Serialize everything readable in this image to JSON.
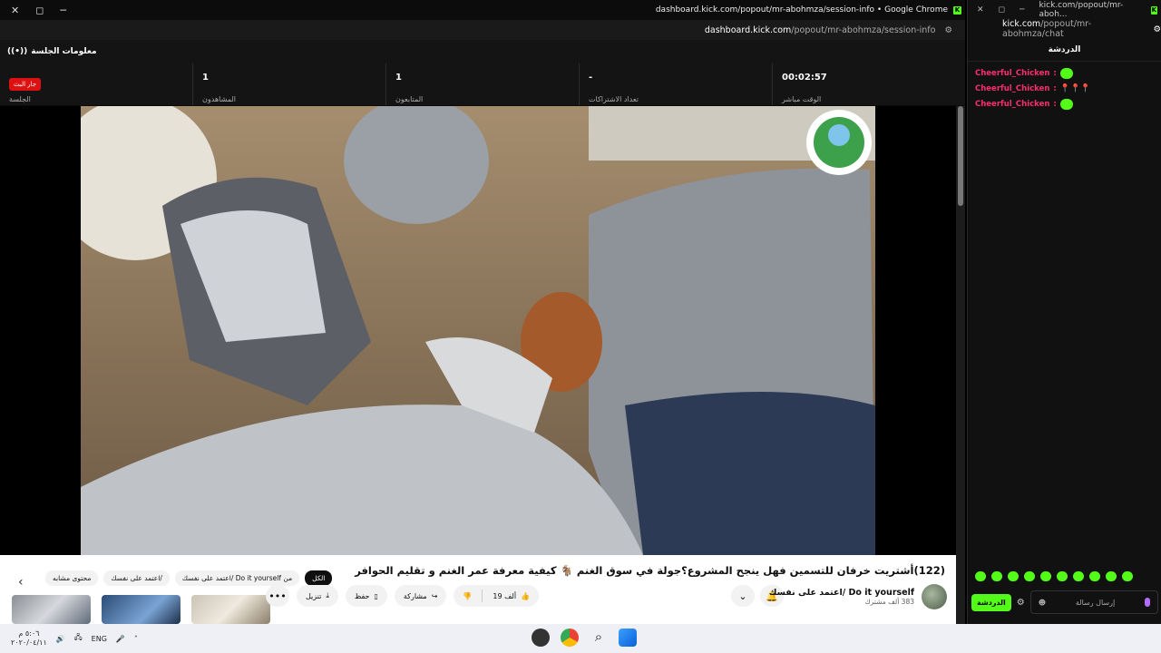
{
  "main_window": {
    "title": "dashboard.kick.com/popout/mr-abohmza/session-info • Google Chrome",
    "url_domain": "dashboard.kick.com",
    "url_path": "/popout/mr-abohmza/session-info",
    "controls": {
      "close": "✕",
      "restore": "◻",
      "minimize": "─"
    }
  },
  "session": {
    "heading": "معلومات الجلسة",
    "live_label": "جار البث",
    "session_label": "الجلسة",
    "stats": [
      {
        "value": "1",
        "label": "المشاهدون"
      },
      {
        "value": "1",
        "label": "المتابعون"
      },
      {
        "value": "-",
        "label": "تعداد الاشتراكات"
      },
      {
        "value": "00:02:57",
        "label": "الوقت مباشر"
      }
    ]
  },
  "youtube": {
    "video_title": "(122)أشتريت خرفان للتسمين فهل ينجح المشروع؟جولة في سوق الغنم 🐐 كيفية معرفة عمر الغنم و تقليم الحوافر",
    "channel_name": "Do it yourself /اعتمد على نفسك",
    "channel_subs": "383 ألف مشترك",
    "like_count": "19 ألف",
    "actions": {
      "share": "مشاركة",
      "save": "حفظ",
      "download": "تنزيل",
      "more": "•••"
    },
    "chips": [
      {
        "label": "الكل",
        "active": true
      },
      {
        "label": "من Do it yourself /اعتمد على نفسك",
        "active": false
      },
      {
        "label": "/اعتمد على نفسك",
        "active": false
      },
      {
        "label": "محتوى مشابه",
        "active": false
      }
    ]
  },
  "chat_window": {
    "title": "kick.com/popout/mr-aboh...",
    "url_domain": "kick.com",
    "url_path": "/popout/mr-abohmza/chat",
    "header": "الدردشة",
    "messages": [
      {
        "user": "Cheerful_Chicken",
        "content": "emote"
      },
      {
        "user": "Cheerful_Chicken",
        "content": "pins"
      },
      {
        "user": "Cheerful_Chicken",
        "content": "emote"
      }
    ],
    "input_placeholder": "إرسال رسالة",
    "send_label": "الدردشة"
  },
  "taskbar": {
    "lang": "ENG",
    "time": "٥:٠٦ م",
    "date": "٢٠٢٠/٠٤/١١"
  },
  "colors": {
    "kick_green": "#53fc18",
    "live_red": "#dd1111",
    "chat_user": "#ff2d6f"
  }
}
